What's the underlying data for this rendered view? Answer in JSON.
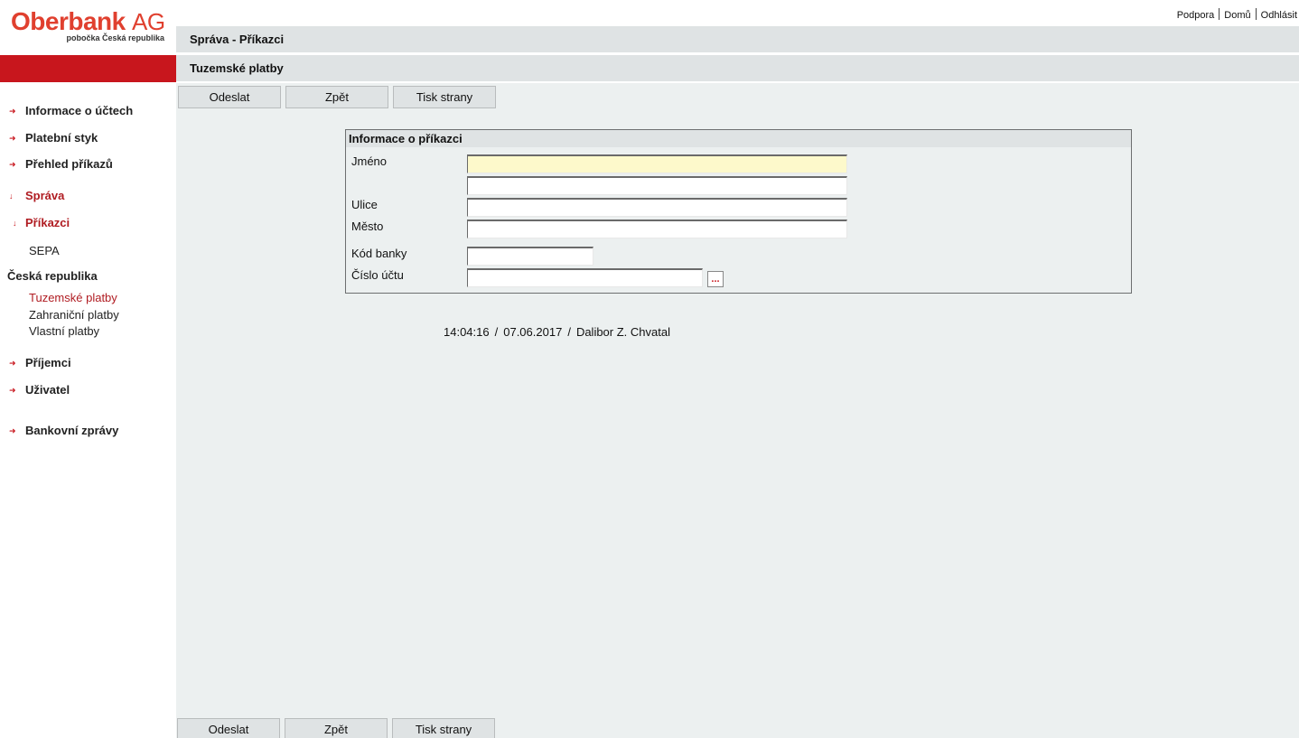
{
  "logo": {
    "brand": "Oberbank",
    "brand_suffix": "AG",
    "subtitle": "pobočka Česká republika"
  },
  "top_links": {
    "support": "Podpora",
    "home": "Domů",
    "logout": "Odhlásit"
  },
  "header": {
    "breadcrumb": "Správa - Příkazci",
    "section": "Tuzemské platby"
  },
  "sidebar": {
    "items": [
      {
        "label": "Informace o účtech"
      },
      {
        "label": "Platební styk"
      },
      {
        "label": "Přehled příkazů"
      },
      {
        "label": "Správa"
      },
      {
        "label": "Příkazci"
      }
    ],
    "sepa": "SEPA",
    "group": "Česká republika",
    "sub_items": [
      {
        "label": "Tuzemské platby"
      },
      {
        "label": "Zahraniční platby"
      },
      {
        "label": "Vlastní platby"
      }
    ],
    "items2": [
      {
        "label": "Příjemci"
      },
      {
        "label": "Uživatel"
      },
      {
        "label": "Bankovní zprávy"
      }
    ]
  },
  "buttons": {
    "send": "Odeslat",
    "back": "Zpět",
    "print": "Tisk strany"
  },
  "form": {
    "title": "Informace o příkazci",
    "name_label": "Jméno",
    "street_label": "Ulice",
    "city_label": "Město",
    "bank_code_label": "Kód banky",
    "account_label": "Číslo účtu",
    "picker": "..."
  },
  "status": {
    "time": "14:04:16",
    "date": "07.06.2017",
    "user": "Dalibor Z. Chvatal"
  },
  "colors": {
    "brand": "#e0402f",
    "accent_red": "#c8161d",
    "bar_gray": "#dfe3e4",
    "content_bg": "#ecf0f0",
    "focus_yellow": "#fdf9cb"
  }
}
